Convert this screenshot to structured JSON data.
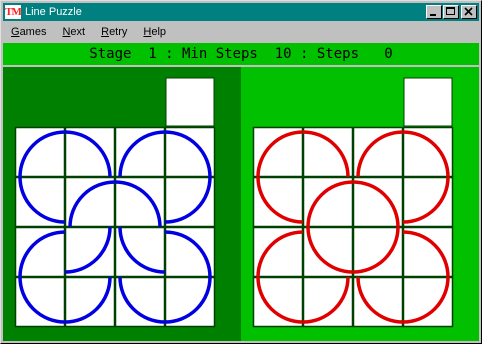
{
  "window": {
    "title": "Line Puzzle",
    "icon_text": "TM",
    "controls": [
      "minimize-icon",
      "maximize-icon",
      "close-icon"
    ]
  },
  "menu": {
    "items": [
      {
        "key": "G",
        "rest": "ames"
      },
      {
        "key": "N",
        "rest": "ext"
      },
      {
        "key": "R",
        "rest": "etry"
      },
      {
        "key": "H",
        "rest": "elp"
      }
    ]
  },
  "status": {
    "text": "Stage  1 : Min Steps  10 : Steps   0"
  },
  "colors": {
    "title_bar": "#008080",
    "status_bar": "#00c000",
    "left_board": "#008000",
    "right_board": "#00c000",
    "tile_border": "#004000",
    "player_line": "#0000e0",
    "target_line": "#e00000"
  },
  "puzzle": {
    "grid": "4x4 tiles plus one spare tile",
    "spare_tile": "empty",
    "player_board": [
      [
        "circle-tl",
        "circle-tr",
        "circle-tl",
        "circle-tr"
      ],
      [
        "circle-bl",
        "arc-inner-tl",
        "arc-inner-tr",
        "circle-br"
      ],
      [
        "circle-tl",
        "arc-inner-br",
        "arc-inner-bl",
        "circle-tr"
      ],
      [
        "circle-bl",
        "circle-br",
        "circle-bl",
        "circle-br"
      ]
    ],
    "target_board": [
      [
        "circle-tl",
        "circle-tr",
        "circle-tl",
        "circle-tr"
      ],
      [
        "circle-bl",
        "arc-inner-tl",
        "arc-inner-tr",
        "circle-br"
      ],
      [
        "circle-tl",
        "arc-inner-bl",
        "arc-inner-br",
        "circle-tr"
      ],
      [
        "circle-bl",
        "circle-br",
        "circle-bl",
        "circle-br"
      ]
    ]
  }
}
